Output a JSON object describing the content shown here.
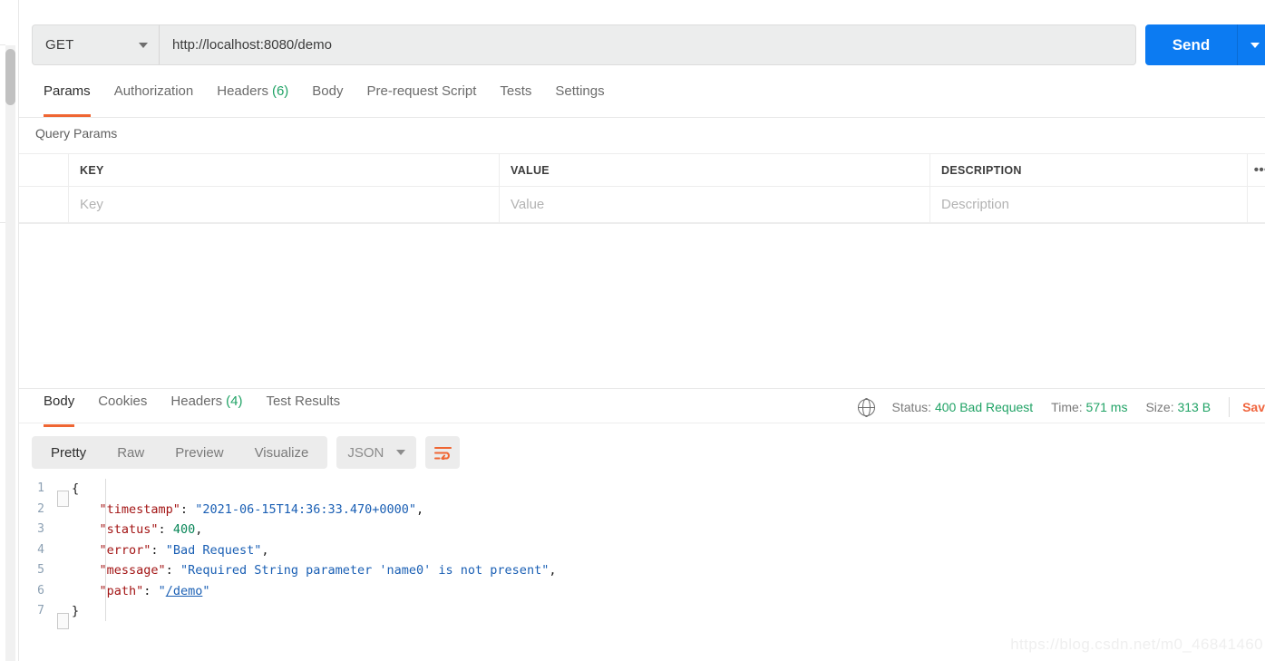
{
  "request": {
    "method": "GET",
    "url": "http://localhost:8080/demo",
    "send_label": "Send",
    "tabs": [
      {
        "label": "Params",
        "badge": "",
        "active": true
      },
      {
        "label": "Authorization",
        "badge": "",
        "active": false
      },
      {
        "label": "Headers",
        "badge": "(6)",
        "active": false
      },
      {
        "label": "Body",
        "badge": "",
        "active": false
      },
      {
        "label": "Pre-request Script",
        "badge": "",
        "active": false
      },
      {
        "label": "Tests",
        "badge": "",
        "active": false
      },
      {
        "label": "Settings",
        "badge": "",
        "active": false
      }
    ],
    "query_params": {
      "section_title": "Query Params",
      "headers": [
        "KEY",
        "VALUE",
        "DESCRIPTION"
      ],
      "row_placeholders": [
        "Key",
        "Value",
        "Description"
      ],
      "bulk_menu_glyph": "•••"
    }
  },
  "response": {
    "tabs": [
      {
        "label": "Body",
        "badge": "",
        "active": true
      },
      {
        "label": "Cookies",
        "badge": "",
        "active": false
      },
      {
        "label": "Headers",
        "badge": "(4)",
        "active": false
      },
      {
        "label": "Test Results",
        "badge": "",
        "active": false
      }
    ],
    "meta": {
      "status_label": "Status:",
      "status_value": "400 Bad Request",
      "time_label": "Time:",
      "time_value": "571 ms",
      "size_label": "Size:",
      "size_value": "313 B",
      "save_label": "Sav",
      "globe_icon": "globe-icon",
      "value_color": "#21a366"
    },
    "body_toolbar": {
      "views": [
        {
          "label": "Pretty",
          "active": true
        },
        {
          "label": "Raw",
          "active": false
        },
        {
          "label": "Preview",
          "active": false
        },
        {
          "label": "Visualize",
          "active": false
        }
      ],
      "format": "JSON",
      "wrap_icon": "wrap-lines-icon",
      "wrap_icon_color": "#ef6633"
    },
    "code": {
      "lines": [
        {
          "no": "1",
          "fold": true,
          "segments": [
            {
              "t": "{",
              "c": "k-brace"
            }
          ]
        },
        {
          "no": "2",
          "fold": false,
          "segments": [
            {
              "t": "    ",
              "c": "k-punc"
            },
            {
              "t": "\"timestamp\"",
              "c": "k-key"
            },
            {
              "t": ": ",
              "c": "k-punc"
            },
            {
              "t": "\"2021-06-15T14:36:33.470+0000\"",
              "c": "k-str"
            },
            {
              "t": ",",
              "c": "k-punc"
            }
          ]
        },
        {
          "no": "3",
          "fold": false,
          "segments": [
            {
              "t": "    ",
              "c": "k-punc"
            },
            {
              "t": "\"status\"",
              "c": "k-key"
            },
            {
              "t": ": ",
              "c": "k-punc"
            },
            {
              "t": "400",
              "c": "k-num"
            },
            {
              "t": ",",
              "c": "k-punc"
            }
          ]
        },
        {
          "no": "4",
          "fold": false,
          "segments": [
            {
              "t": "    ",
              "c": "k-punc"
            },
            {
              "t": "\"error\"",
              "c": "k-key"
            },
            {
              "t": ": ",
              "c": "k-punc"
            },
            {
              "t": "\"Bad Request\"",
              "c": "k-str"
            },
            {
              "t": ",",
              "c": "k-punc"
            }
          ]
        },
        {
          "no": "5",
          "fold": false,
          "segments": [
            {
              "t": "    ",
              "c": "k-punc"
            },
            {
              "t": "\"message\"",
              "c": "k-key"
            },
            {
              "t": ": ",
              "c": "k-punc"
            },
            {
              "t": "\"Required String parameter 'name0' is not present\"",
              "c": "k-str"
            },
            {
              "t": ",",
              "c": "k-punc"
            }
          ]
        },
        {
          "no": "6",
          "fold": false,
          "segments": [
            {
              "t": "    ",
              "c": "k-punc"
            },
            {
              "t": "\"path\"",
              "c": "k-key"
            },
            {
              "t": ": ",
              "c": "k-punc"
            },
            {
              "t": "\"",
              "c": "k-str"
            },
            {
              "t": "/demo",
              "c": "k-link"
            },
            {
              "t": "\"",
              "c": "k-str"
            }
          ]
        },
        {
          "no": "7",
          "fold": true,
          "segments": [
            {
              "t": "}",
              "c": "k-brace"
            }
          ]
        }
      ]
    }
  },
  "watermark": "https://blog.csdn.net/m0_46841460",
  "colors": {
    "accent_orange": "#ef6633",
    "send_blue": "#0c7bf2",
    "status_green": "#21a366"
  }
}
